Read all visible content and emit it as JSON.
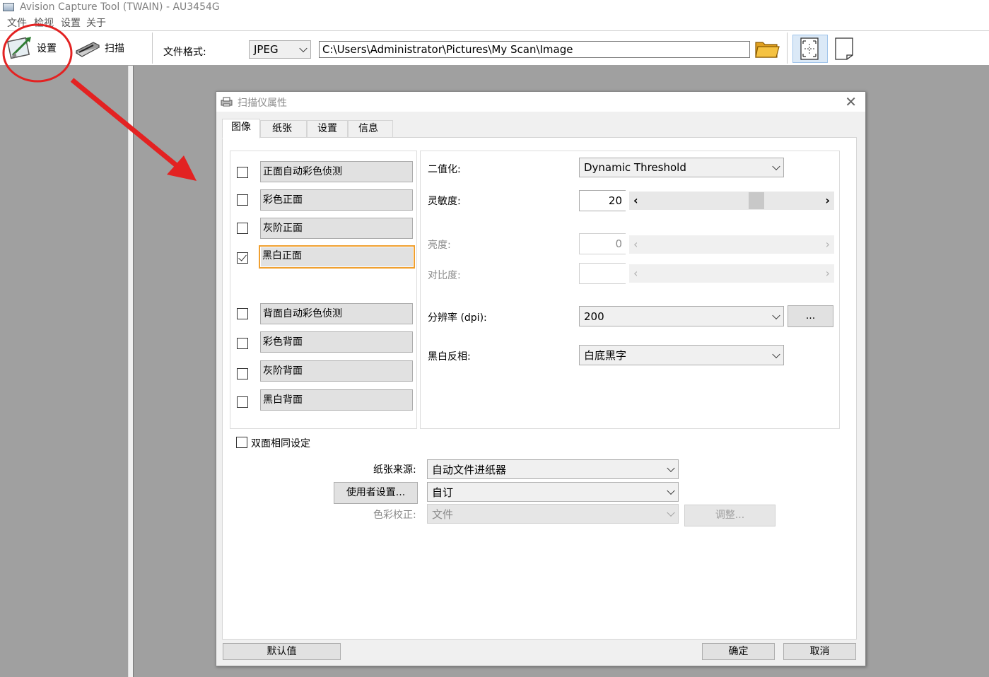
{
  "window": {
    "title": "Avision Capture Tool (TWAIN) - AU3454G"
  },
  "menu": [
    "文件",
    "检视",
    "设置",
    "关于"
  ],
  "toolbar": {
    "settings_label": "设置",
    "scan_label": "扫描",
    "file_format_label": "文件格式:",
    "file_format_value": "JPEG",
    "path_value": "C:\\Users\\Administrator\\Pictures\\My Scan\\Image"
  },
  "dialog": {
    "title": "扫描仪属性",
    "tabs": [
      "图像",
      "纸张",
      "设置",
      "信息"
    ],
    "image_options": [
      {
        "label": "正面自动彩色侦测",
        "checked": false
      },
      {
        "label": "彩色正面",
        "checked": false
      },
      {
        "label": "灰阶正面",
        "checked": false
      },
      {
        "label": "黑白正面",
        "checked": true
      },
      {
        "label": "背面自动彩色侦测",
        "checked": false
      },
      {
        "label": "彩色背面",
        "checked": false
      },
      {
        "label": "灰阶背面",
        "checked": false
      },
      {
        "label": "黑白背面",
        "checked": false
      }
    ],
    "binarization_label": "二值化:",
    "binarization_value": "Dynamic Threshold",
    "sensitivity_label": "灵敏度:",
    "sensitivity_value": "20",
    "brightness_label": "亮度:",
    "brightness_value": "0",
    "contrast_label": "对比度:",
    "contrast_value": "",
    "resolution_label": "分辨率 (dpi):",
    "resolution_value": "200",
    "resolution_more": "...",
    "invert_label": "黑白反相:",
    "invert_value": "白底黑字",
    "duplex_same_label": "双面相同设定",
    "paper_source_label": "纸张来源:",
    "paper_source_value": "自动文件进纸器",
    "user_settings_button": "使用者设置...",
    "user_settings_value": "自订",
    "color_calib_label": "色彩校正:",
    "color_calib_value": "文件",
    "adjust_button": "调整...",
    "default_button": "默认值",
    "ok_button": "确定",
    "cancel_button": "取消"
  }
}
